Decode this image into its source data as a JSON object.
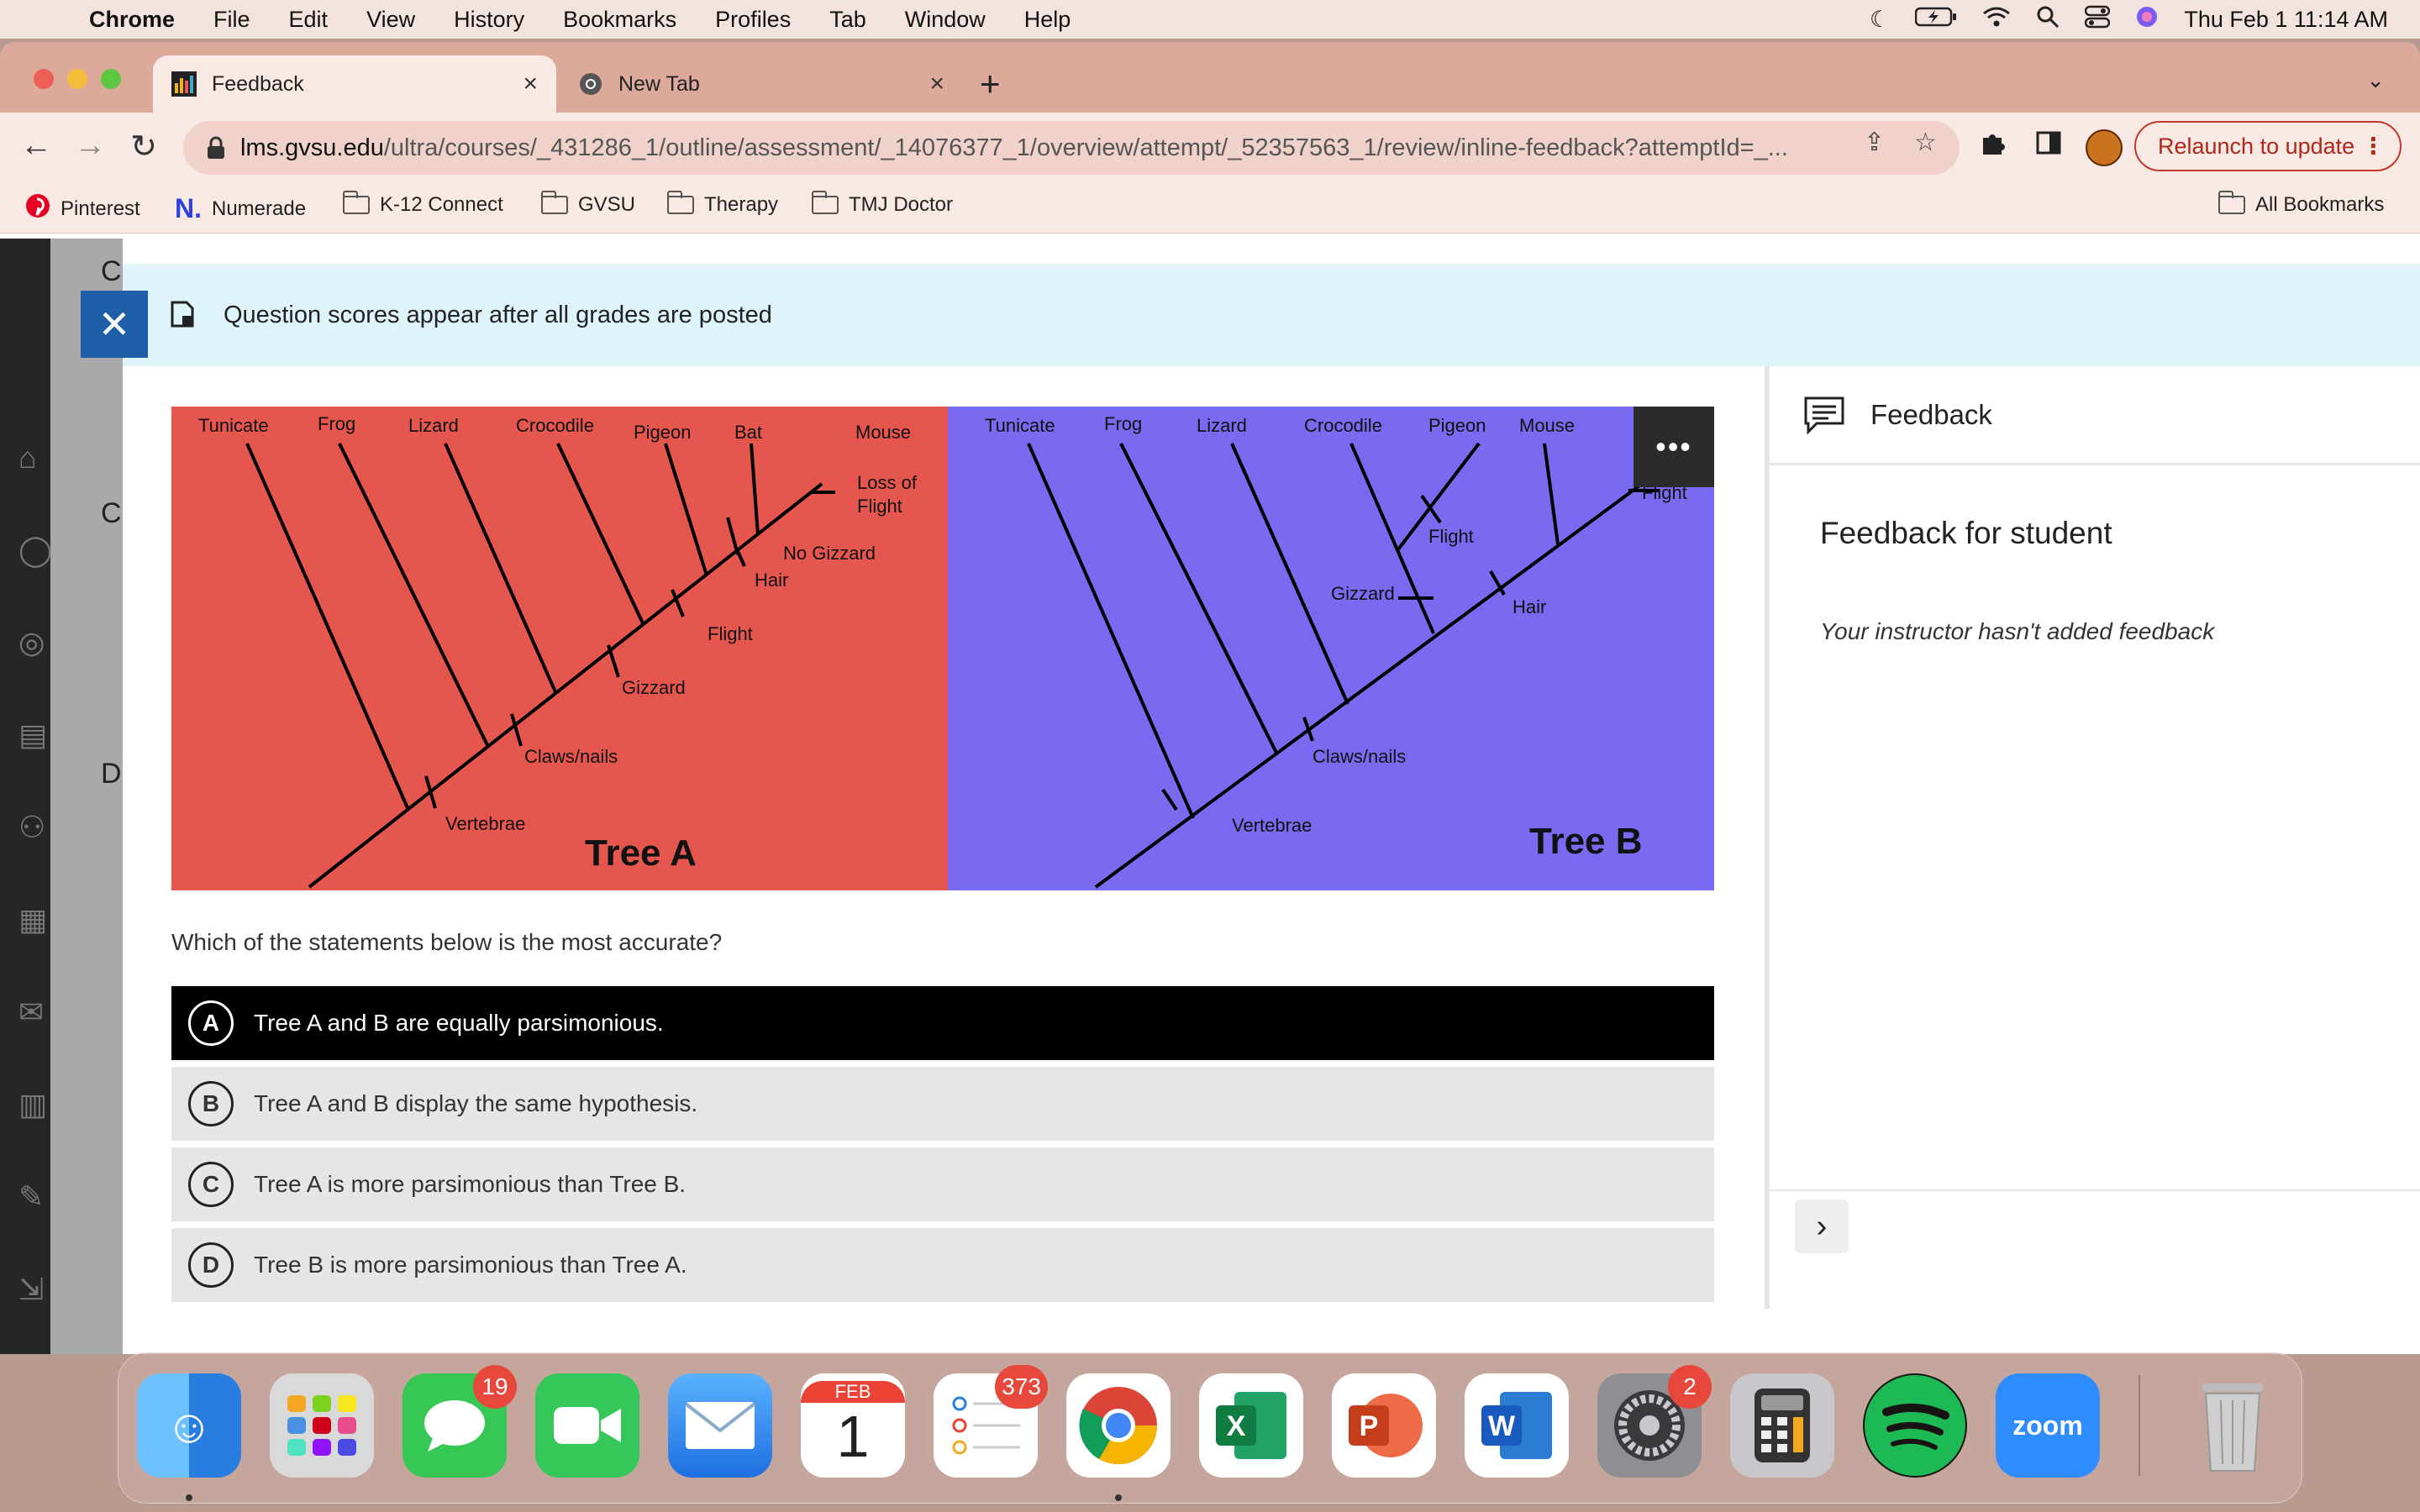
{
  "menubar": {
    "app": "Chrome",
    "items": [
      "File",
      "Edit",
      "View",
      "History",
      "Bookmarks",
      "Profiles",
      "Tab",
      "Window",
      "Help"
    ],
    "datetime": "Thu Feb 1  11:14 AM"
  },
  "tabs": [
    {
      "title": "Feedback",
      "active": true
    },
    {
      "title": "New Tab",
      "active": false
    }
  ],
  "omnibox": {
    "host": "lms.gvsu.edu",
    "path": "/ultra/courses/_431286_1/outline/assessment/_14076377_1/overview/attempt/_52357563_1/review/inline-feedback?attemptId=_..."
  },
  "relaunch_label": "Relaunch to update",
  "bookmarks": [
    {
      "label": "Pinterest",
      "icon": "pinterest-icon"
    },
    {
      "label": "Numerade",
      "icon": "numerade-icon"
    },
    {
      "label": "K-12 Connect",
      "icon": "folder-icon"
    },
    {
      "label": "GVSU",
      "icon": "folder-icon"
    },
    {
      "label": "Therapy",
      "icon": "folder-icon"
    },
    {
      "label": "TMJ Doctor",
      "icon": "folder-icon"
    }
  ],
  "all_bookmarks": "All Bookmarks",
  "notice": "Question scores appear after all grades are posted",
  "figure": {
    "tree_a": {
      "bg": "#e5574e",
      "title": "Tree A",
      "taxa": [
        "Tunicate",
        "Frog",
        "Lizard",
        "Crocodile",
        "Pigeon",
        "Bat",
        "Mouse"
      ],
      "traits": [
        "Vertebrae",
        "Claws/nails",
        "Gizzard",
        "Flight",
        "Hair",
        "No Gizzard",
        "Loss of",
        "Flight"
      ]
    },
    "tree_b": {
      "bg": "#7a6af0",
      "title": "Tree B",
      "taxa": [
        "Tunicate",
        "Frog",
        "Lizard",
        "Crocodile",
        "Pigeon",
        "Mouse"
      ],
      "traits": [
        "Vertebrae",
        "Claws/nails",
        "Gizzard",
        "Flight",
        "Hair",
        "Flight"
      ]
    }
  },
  "question": "Which of the statements below is the most accurate?",
  "choices": [
    {
      "letter": "A",
      "text": "Tree A and B are equally parsimonious.",
      "selected": true
    },
    {
      "letter": "B",
      "text": "Tree A and B display the same hypothesis.",
      "selected": false
    },
    {
      "letter": "C",
      "text": "Tree A is more parsimonious than Tree B.",
      "selected": false
    },
    {
      "letter": "D",
      "text": "Tree B is more parsimonious than Tree A.",
      "selected": false
    }
  ],
  "feedback": {
    "header": "Feedback",
    "title": "Feedback for student",
    "empty": "Your instructor hasn't added feedback"
  },
  "lms_letters": [
    "Co",
    "C",
    "D"
  ],
  "dock": {
    "apps": [
      {
        "name": "Finder",
        "color": "#3b8ef0"
      },
      {
        "name": "Launchpad",
        "color": "#d9d9d9"
      },
      {
        "name": "Messages",
        "color": "#37c754",
        "badge": "19"
      },
      {
        "name": "FaceTime",
        "color": "#34c759"
      },
      {
        "name": "Mail",
        "color": "#3d8df0"
      },
      {
        "name": "Calendar",
        "color": "#ffffff",
        "month": "FEB",
        "day": "1"
      },
      {
        "name": "Reminders",
        "color": "#ffffff",
        "badge": "373"
      },
      {
        "name": "Chrome",
        "color": "#ffffff"
      },
      {
        "name": "Excel",
        "color": "#ffffff"
      },
      {
        "name": "PowerPoint",
        "color": "#ffffff"
      },
      {
        "name": "Word",
        "color": "#ffffff"
      },
      {
        "name": "System Settings",
        "color": "#8e8e93",
        "badge": "2"
      },
      {
        "name": "Calculator",
        "color": "#c7c7cc"
      },
      {
        "name": "Spotify",
        "color": "#1db954"
      },
      {
        "name": "Zoom",
        "color": "#2d8cff",
        "label": "zoom"
      },
      {
        "name": "Trash",
        "color": "#b8b8b8"
      }
    ]
  }
}
